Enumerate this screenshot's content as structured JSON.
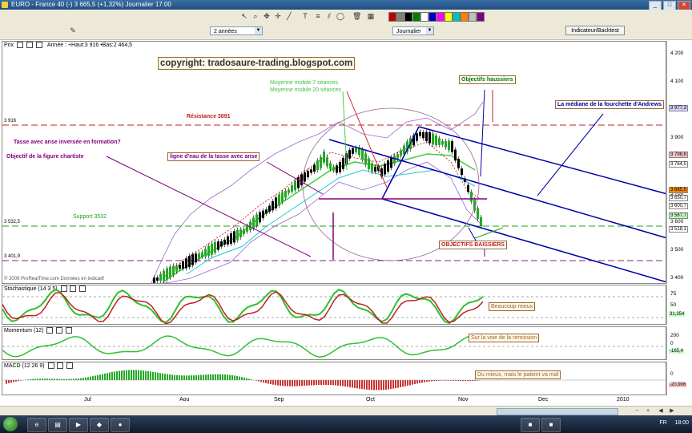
{
  "window": {
    "title": "EURO - France 40 (-)    3 665,5 (+1,32%)    Journalier  17:00"
  },
  "toolbar": {
    "icons": [
      "cursor-icon",
      "zoom-icon",
      "pan-icon",
      "crosshair-icon",
      "line-icon",
      "text-icon",
      "fib-icon",
      "channel-icon",
      "ellipse-icon",
      "delete-icon",
      "palette-icon"
    ],
    "swatch_colors": [
      "#c00000",
      "#808080",
      "#000000",
      "#008000",
      "#ffffff",
      "#0000c0",
      "#ff00ff",
      "#ffff00",
      "#00c0c0",
      "#ff8000",
      "#c0c0c0",
      "#800080"
    ]
  },
  "controls": {
    "period": "2 années",
    "interval": "Journalier",
    "indicator_button": "Indicateur/Backtest"
  },
  "price_panel": {
    "label": "Prix",
    "info": "Année : +Haut:3 916 •Bas:2 464,5",
    "footer": "© 2009 ProRealTime.com  Données en indicatif"
  },
  "annotations": {
    "copyright": "copyright: tradosaure-trading.blogspot.com",
    "ma7": "Moyenne mobile 7 séances",
    "ma20": "Moyenne mobile 20 séances",
    "objectifs_haussiers": "Objectifs haussiers",
    "mediane": "La médiane de la fourchette d'Andrews",
    "resistance": "Résistance 3891",
    "tasse": "Tasse avec anse inversée en formation?",
    "objectif_figure": "Objectif de la figure chartiste",
    "ligne_eau": "ligne d'eau de la tasse avec anse",
    "support": "Support 3532",
    "objectifs_baissiers": "OBJECTIFS BAISSIERS",
    "level_3916": "3 916",
    "level_3532": "3 532,5",
    "level_3401": "3 401,9"
  },
  "price_axis": {
    "ticks": [
      "4 200",
      "4 100",
      "4 000",
      "3 900",
      "3 800",
      "3 700",
      "3 600",
      "3 500",
      "3 400"
    ],
    "badges": [
      {
        "text": "3 977,3",
        "color": "#d0d0ff"
      },
      {
        "text": "3 798,8",
        "color": "#ffc0c0"
      },
      {
        "text": "3 764,5",
        "color": "#ffffff"
      },
      {
        "text": "3 685,5",
        "color": "#ff8800"
      },
      {
        "text": "3 650,7",
        "color": "#ffffff"
      },
      {
        "text": "3 600,7",
        "color": "#ffffff"
      },
      {
        "text": "3 567,7",
        "color": "#c0ffc0"
      },
      {
        "text": "3 518,1",
        "color": "#ffffff"
      }
    ]
  },
  "stoch_panel": {
    "label": "Stochastique (14 3 5)",
    "comment": "Beaucoup mieux",
    "ticks": [
      "75",
      "50",
      "25"
    ],
    "value": "31,354"
  },
  "momentum_panel": {
    "label": "Momentum (12)",
    "comment": "Sur la voie de la remission",
    "ticks": [
      "200",
      "0",
      "-200"
    ],
    "value": "-165,4"
  },
  "macd_panel": {
    "label": "MACD (12 26 9)",
    "comment": "Du mieux, mais le patient va mal",
    "ticks": [
      "0",
      "-20"
    ],
    "value": "-20,906"
  },
  "time_axis": [
    "Jul",
    "Aou",
    "Sep",
    "Oct",
    "Nov",
    "Dec",
    "2010"
  ],
  "taskbar": {
    "lang": "FR",
    "clock": "18:00"
  }
}
